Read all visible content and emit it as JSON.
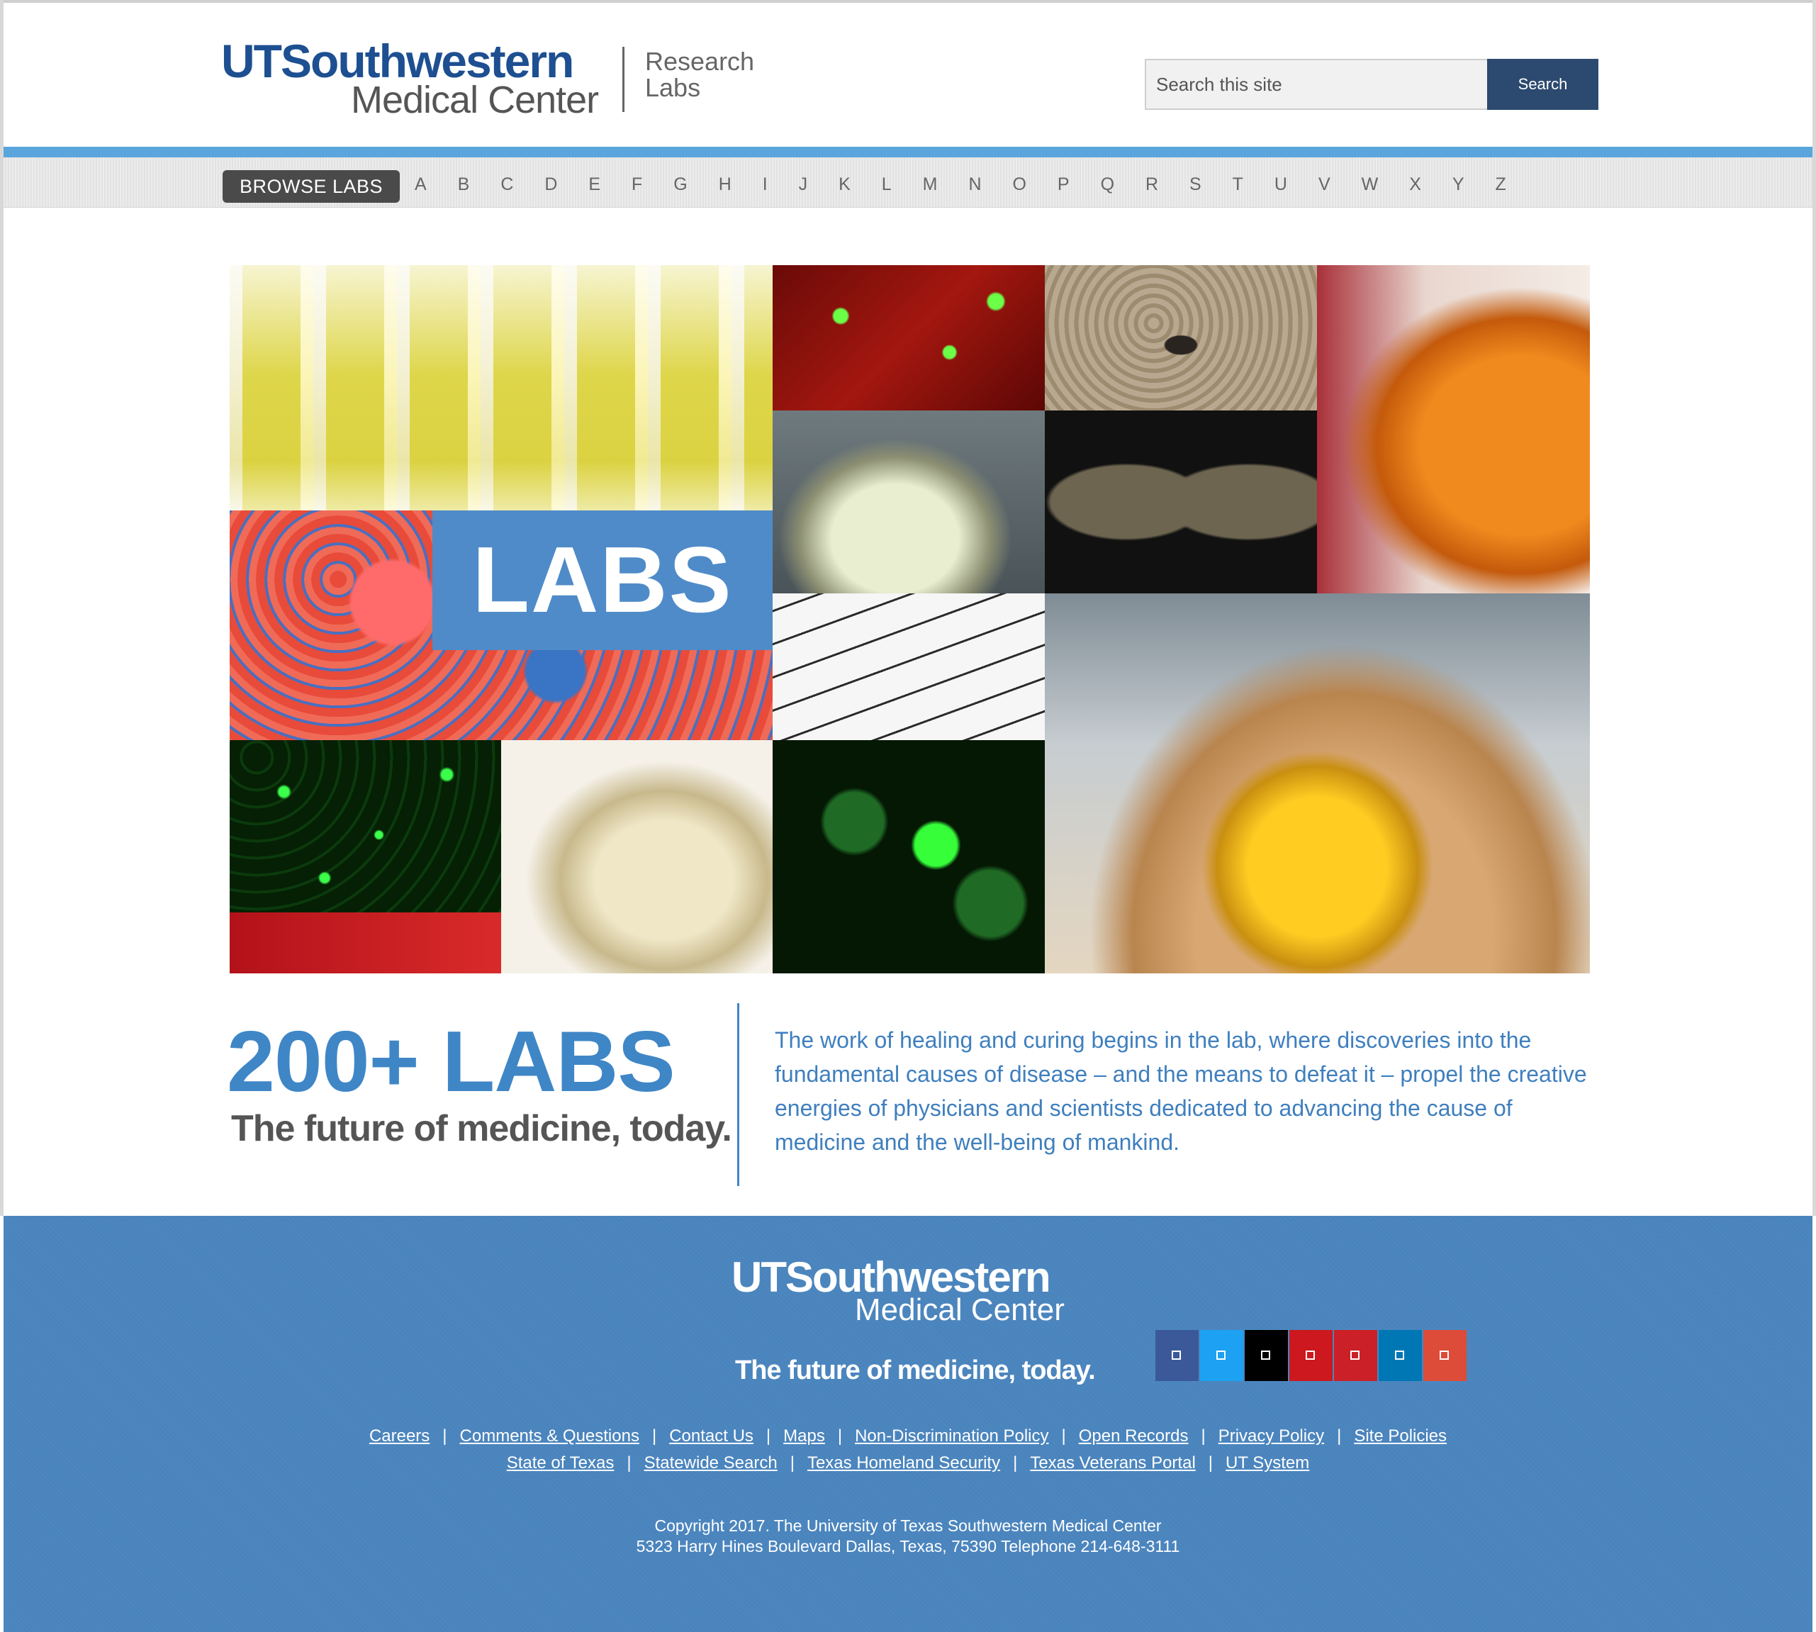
{
  "header": {
    "logo_line1": "UTSouthwestern",
    "logo_line2": "Medical Center",
    "logo_sub_line1": "Research",
    "logo_sub_line2": "Labs",
    "search_placeholder": "Search this site",
    "search_button": "Search"
  },
  "browse": {
    "button_label": "BROWSE LABS",
    "letters": [
      "A",
      "B",
      "C",
      "D",
      "E",
      "F",
      "G",
      "H",
      "I",
      "J",
      "K",
      "L",
      "M",
      "N",
      "O",
      "P",
      "Q",
      "R",
      "S",
      "T",
      "U",
      "V",
      "W",
      "X",
      "Y",
      "Z"
    ]
  },
  "hero": {
    "overlay_text": "LABS"
  },
  "intro": {
    "count_headline": "200+ LABS",
    "tagline": "The future of medicine, today.",
    "paragraph": "The work of healing and curing begins in the lab, where discoveries into the fundamental causes of disease – and the means to defeat it – propel the creative energies of physicians and scientists dedicated to advancing the cause of medicine and the well-being of mankind."
  },
  "footer": {
    "logo_line1": "UTSouthwestern",
    "logo_line2": "Medical Center",
    "tagline": "The future of medicine, today.",
    "social": [
      {
        "name": "facebook-icon",
        "color": "#3b5998"
      },
      {
        "name": "twitter-icon",
        "color": "#1da1f2"
      },
      {
        "name": "instagram-icon",
        "color": "#000000"
      },
      {
        "name": "youtube-icon",
        "color": "#cc181e"
      },
      {
        "name": "pinterest-icon",
        "color": "#cb2027"
      },
      {
        "name": "linkedin-icon",
        "color": "#0077b5"
      },
      {
        "name": "google-plus-icon",
        "color": "#dd4b39"
      }
    ],
    "links_row1": [
      "Careers",
      "Comments & Questions",
      "Contact Us",
      "Maps",
      "Non-Discrimination Policy",
      "Open Records",
      "Privacy Policy",
      "Site Policies"
    ],
    "links_row2": [
      "State of Texas",
      "Statewide Search",
      "Texas Homeland Security",
      "Texas Veterans Portal",
      "UT System"
    ],
    "separator": "|",
    "copyright_line1": "Copyright 2017. The University of Texas Southwestern Medical Center",
    "copyright_line2": "5323 Harry Hines Boulevard Dallas, Texas, 75390 Telephone 214-648-3111"
  },
  "colors": {
    "brand_blue": "#1d4f91",
    "accent_blue": "#5aa6dc",
    "footer_blue": "#4a84bd",
    "search_button": "#2c4a6f"
  }
}
